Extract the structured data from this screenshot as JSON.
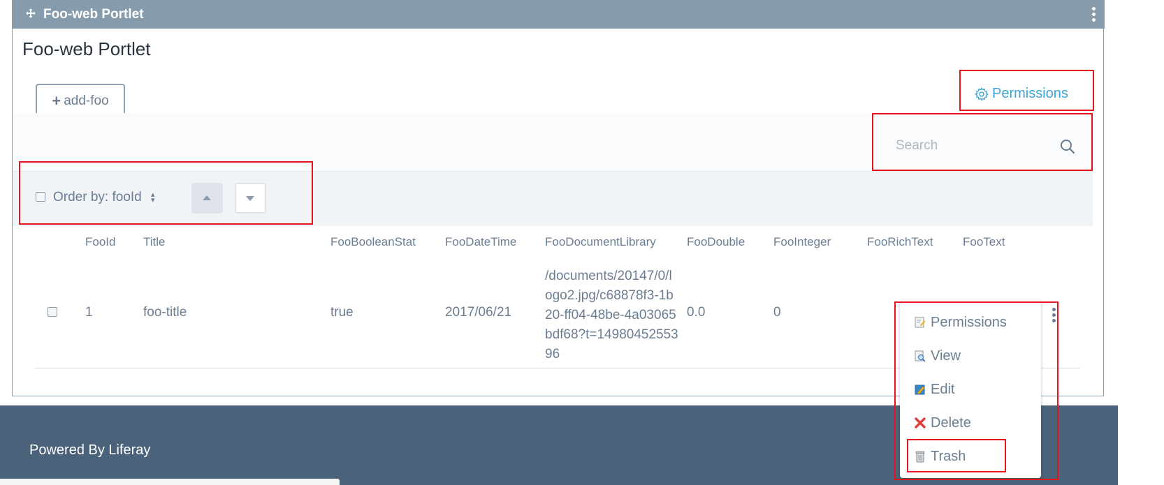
{
  "portlet": {
    "bar_title": "Foo-web Portlet",
    "heading": "Foo-web Portlet"
  },
  "toolbar": {
    "add_label": "add-foo",
    "permissions_label": "Permissions"
  },
  "search": {
    "placeholder": "Search",
    "value": ""
  },
  "management_bar": {
    "order_by_label": "Order by: fooId"
  },
  "table": {
    "headers": [
      "FooId",
      "Title",
      "FooBooleanStat",
      "FooDateTime",
      "FooDocumentLibrary",
      "FooDouble",
      "FooInteger",
      "FooRichText",
      "FooText"
    ],
    "rows": [
      {
        "foo_id": "1",
        "title": "foo-title",
        "boolean": "true",
        "date": "2017/06/21",
        "document": "/documents/20147/0/logo2.jpg/c68878f3-1b20-ff04-48be-4a03065bdf68?t=1498045255396",
        "double": "0.0",
        "integer": "0",
        "rich_text": "",
        "text": ""
      }
    ]
  },
  "actions_menu": {
    "items": [
      {
        "label": "Permissions",
        "icon": "permissions-icon"
      },
      {
        "label": "View",
        "icon": "view-icon"
      },
      {
        "label": "Edit",
        "icon": "edit-icon"
      },
      {
        "label": "Delete",
        "icon": "delete-icon"
      },
      {
        "label": "Trash",
        "icon": "trash-icon"
      }
    ]
  },
  "footer": {
    "powered_by": "Powered By Liferay"
  },
  "colors": {
    "topbar": "#869cad",
    "link_blue": "#3ea3d9",
    "footer": "#4a637a",
    "highlight_red": "#e8131d"
  }
}
